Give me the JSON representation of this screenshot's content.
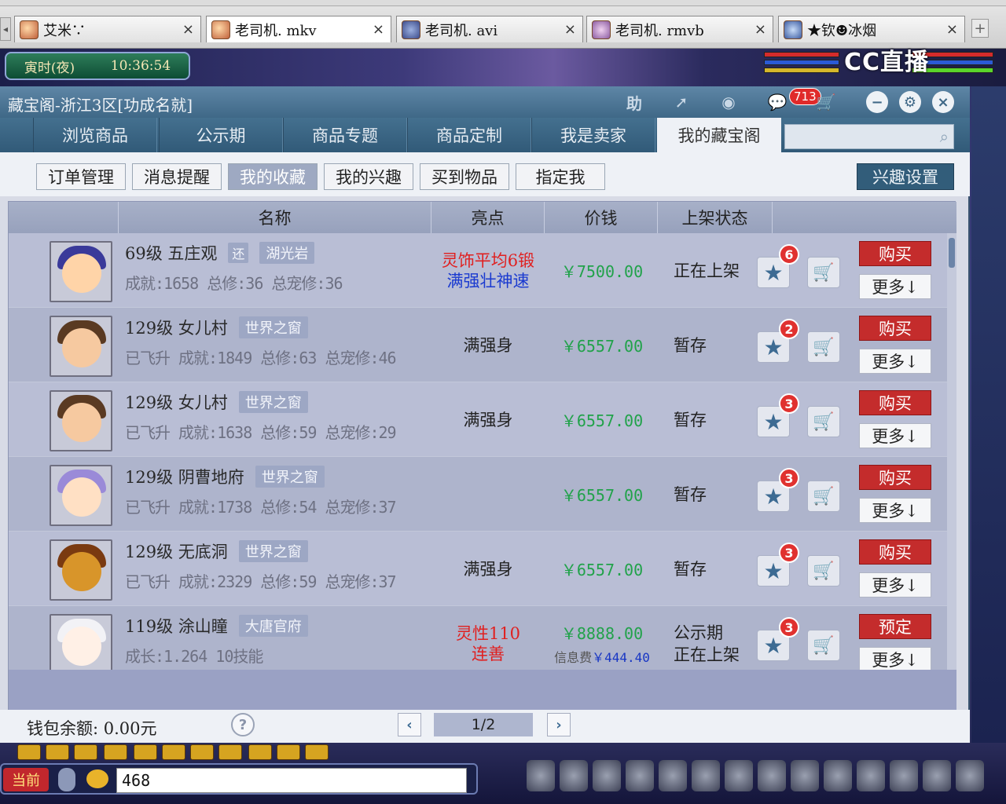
{
  "browser_tabs": [
    {
      "label": "艾米∵",
      "active": false
    },
    {
      "label": "老司机. mkv",
      "active": true
    },
    {
      "label": "老司机. avi",
      "active": false
    },
    {
      "label": "老司机. rmvb",
      "active": false
    },
    {
      "label": "★钦☻冰烟",
      "active": false
    }
  ],
  "game": {
    "time_period": "寅时(夜)",
    "clock": "10:36:54",
    "stream_logo": "CC直播",
    "chat_channel": "当前",
    "chat_input": "468"
  },
  "window": {
    "title": "藏宝阁-浙江3区[功成名就]",
    "help_label": "助",
    "message_count": "713"
  },
  "nav_tabs": [
    "浏览商品",
    "公示期",
    "商品专题",
    "商品定制",
    "我是卖家",
    "我的藏宝阁"
  ],
  "nav_active": "我的藏宝阁",
  "sub_tabs": [
    "订单管理",
    "消息提醒",
    "我的收藏",
    "我的兴趣",
    "买到物品",
    "指定我"
  ],
  "sub_active": "我的收藏",
  "interest_settings": "兴趣设置",
  "columns": {
    "name": "名称",
    "highlight": "亮点",
    "price": "价钱",
    "status": "上架状态"
  },
  "rows": [
    {
      "level_school": "69级 五庄观",
      "extra_tag": "还",
      "server_tag": "湖光岩",
      "detail": "成就:1658 总修:36 总宠修:36",
      "highlight": [
        "灵饰平均6锻",
        "满强壮神速"
      ],
      "highlight_colors": [
        "#e02020",
        "#1a3ad0"
      ],
      "price": "￥7500.00",
      "fee": "",
      "status": [
        "正在上架"
      ],
      "fav_count": "6",
      "action": "购买",
      "more": "更多↓"
    },
    {
      "level_school": "129级 女儿村",
      "extra_tag": "",
      "server_tag": "世界之窗",
      "detail": "已飞升 成就:1849 总修:63 总宠修:46",
      "highlight": [
        "满强身"
      ],
      "highlight_colors": [
        "#222222"
      ],
      "price": "￥6557.00",
      "fee": "",
      "status": [
        "暂存"
      ],
      "fav_count": "2",
      "action": "购买",
      "more": "更多↓"
    },
    {
      "level_school": "129级 女儿村",
      "extra_tag": "",
      "server_tag": "世界之窗",
      "detail": "已飞升 成就:1638 总修:59 总宠修:29",
      "highlight": [
        "满强身"
      ],
      "highlight_colors": [
        "#222222"
      ],
      "price": "￥6557.00",
      "fee": "",
      "status": [
        "暂存"
      ],
      "fav_count": "3",
      "action": "购买",
      "more": "更多↓"
    },
    {
      "level_school": "129级 阴曹地府",
      "extra_tag": "",
      "server_tag": "世界之窗",
      "detail": "已飞升 成就:1738 总修:54 总宠修:37",
      "highlight": [],
      "highlight_colors": [],
      "price": "￥6557.00",
      "fee": "",
      "status": [
        "暂存"
      ],
      "fav_count": "3",
      "action": "购买",
      "more": "更多↓"
    },
    {
      "level_school": "129级 无底洞",
      "extra_tag": "",
      "server_tag": "世界之窗",
      "detail": "已飞升 成就:2329 总修:59 总宠修:37",
      "highlight": [
        "满强身"
      ],
      "highlight_colors": [
        "#222222"
      ],
      "price": "￥6557.00",
      "fee": "",
      "status": [
        "暂存"
      ],
      "fav_count": "3",
      "action": "购买",
      "more": "更多↓"
    },
    {
      "level_school": "119级 涂山瞳",
      "extra_tag": "",
      "server_tag": "大唐官府",
      "detail": "成长:1.264 10技能",
      "highlight": [
        "灵性110",
        "连善"
      ],
      "highlight_colors": [
        "#e02020",
        "#e02020"
      ],
      "price": "￥8888.00",
      "fee_label": "信息费",
      "fee": "￥444.40",
      "status": [
        "公示期",
        "正在上架"
      ],
      "fav_count": "3",
      "action": "预定",
      "more": "更多↓"
    }
  ],
  "footer": {
    "wallet": "钱包余额: 0.00元",
    "page": "1/2"
  },
  "colors": {
    "titlebar": "#4e7898",
    "buy_button": "#c42c2c",
    "price": "#21a24a",
    "badge": "#e0312f"
  }
}
